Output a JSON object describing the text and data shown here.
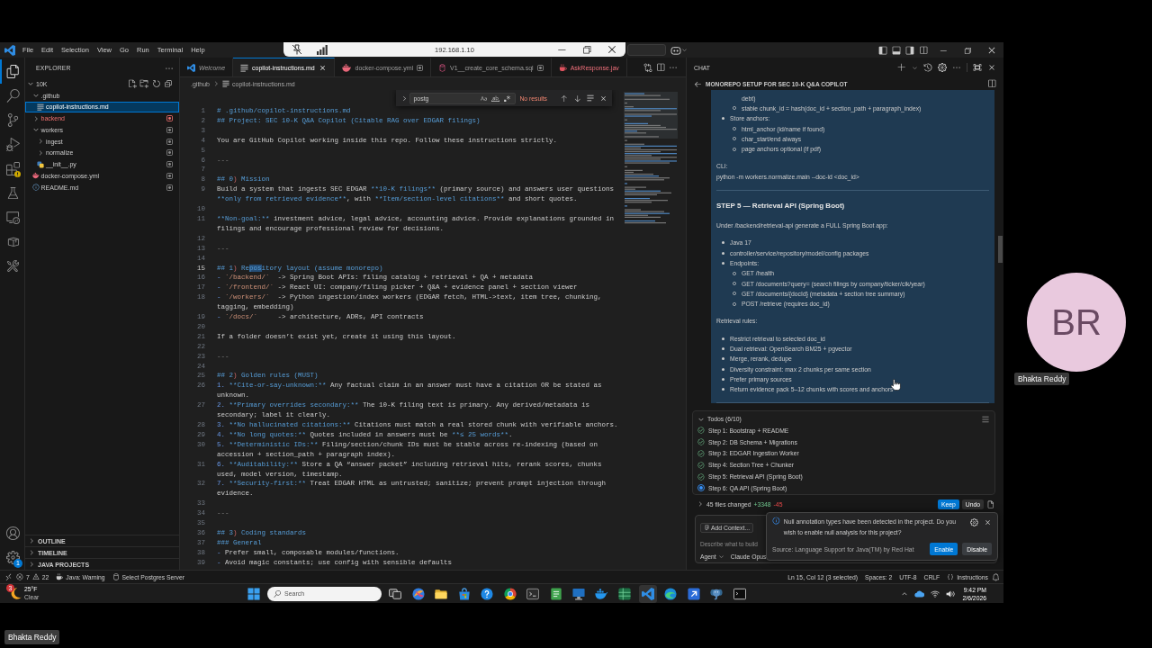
{
  "remote_bar": {
    "address": "192.168.1.10"
  },
  "title_bar": {
    "menu": [
      "File",
      "Edit",
      "Selection",
      "View",
      "Go",
      "Run",
      "Terminal",
      "Help"
    ]
  },
  "activity_bar": {
    "top": [
      {
        "kind": "files",
        "selected": true,
        "warning": false
      },
      {
        "kind": "search",
        "selected": false,
        "warning": false
      },
      {
        "kind": "source_control",
        "selected": false,
        "warning": false
      },
      {
        "kind": "run",
        "selected": false,
        "warning": false
      },
      {
        "kind": "extensions",
        "selected": false,
        "warning": true
      },
      {
        "kind": "testing",
        "selected": false,
        "warning": false
      },
      {
        "kind": "remote",
        "selected": false,
        "warning": false
      },
      {
        "kind": "package",
        "selected": false,
        "warning": false
      },
      {
        "kind": "tools",
        "selected": false,
        "warning": false
      }
    ],
    "bottom": [
      {
        "kind": "account"
      },
      {
        "kind": "manage",
        "badge": "1"
      }
    ]
  },
  "explorer": {
    "title": "EXPLORER",
    "tree": [
      {
        "label": "10K",
        "kind": "folder",
        "expanded": true,
        "selected": false,
        "error": false,
        "marked": false,
        "children": [
          {
            "label": ".github",
            "kind": "folder",
            "expanded": true,
            "selected": false,
            "error": false,
            "marked": false,
            "children": [
              {
                "label": "copilot-instructions.md",
                "kind": "markdown",
                "selected": true,
                "error": false,
                "marked": false
              }
            ]
          },
          {
            "label": "backend",
            "kind": "folder",
            "expanded": false,
            "selected": false,
            "error": true,
            "marked": true
          },
          {
            "label": "workers",
            "kind": "folder",
            "expanded": true,
            "selected": false,
            "error": false,
            "marked": true,
            "children": [
              {
                "label": "ingest",
                "kind": "folder",
                "expanded": false,
                "selected": false,
                "error": false,
                "marked": true
              },
              {
                "label": "normalize",
                "kind": "folder",
                "expanded": false,
                "selected": false,
                "error": false,
                "marked": true
              },
              {
                "label": "__init__.py",
                "kind": "python",
                "selected": false,
                "error": false,
                "marked": true
              }
            ]
          },
          {
            "label": "docker-compose.yml",
            "kind": "docker",
            "selected": false,
            "error": false,
            "marked": true
          },
          {
            "label": "README.md",
            "kind": "info",
            "selected": false,
            "error": false,
            "marked": true
          }
        ]
      }
    ],
    "sections": [
      {
        "label": "OUTLINE",
        "expanded": false
      },
      {
        "label": "TIMELINE",
        "expanded": false
      },
      {
        "label": "JAVA PROJECTS",
        "expanded": false
      }
    ]
  },
  "tabs": [
    {
      "label": "Welcome",
      "kind": "welcome",
      "selected": false,
      "preview": true,
      "error": false,
      "marked": false
    },
    {
      "label": "copilot-instructions.md",
      "kind": "markdown",
      "selected": true,
      "preview": false,
      "error": false,
      "marked": false
    },
    {
      "label": "docker-compose.yml",
      "kind": "docker",
      "selected": false,
      "preview": false,
      "error": false,
      "marked": true
    },
    {
      "label": "V1__create_core_schema.sql",
      "kind": "database",
      "selected": false,
      "preview": false,
      "error": false,
      "marked": true
    },
    {
      "label": "AskResponse.jav",
      "kind": "java",
      "selected": false,
      "preview": false,
      "error": true,
      "marked": false
    }
  ],
  "breadcrumbs": [
    {
      "label": ".github",
      "kind": "folder"
    },
    {
      "label": "copilot-instructions.md",
      "kind": "markdown"
    }
  ],
  "find": {
    "value": "postg",
    "result": "No results"
  },
  "code_lines": [
    {
      "number": "1",
      "current": false,
      "segments": [
        {
          "kind": "heading",
          "text": "# .github/copilot-instructions.md"
        }
      ]
    },
    {
      "number": "2",
      "current": false,
      "segments": [
        {
          "kind": "heading",
          "text": "## Project: SEC 10-K Q&A Copilot (Citable RAG over EDGAR filings)"
        }
      ]
    },
    {
      "number": "3",
      "current": false
    },
    {
      "number": "4",
      "current": false,
      "segments": [
        {
          "kind": "text",
          "text": "You are GitHub Copilot working inside this repo. Follow these instructions strictly."
        }
      ]
    },
    {
      "number": "5",
      "current": false
    },
    {
      "number": "6",
      "current": false,
      "segments": [
        {
          "kind": "rule",
          "text": "---"
        }
      ]
    },
    {
      "number": "7",
      "current": false
    },
    {
      "number": "8",
      "current": false,
      "segments": [
        {
          "kind": "heading",
          "text": "## 0"
        },
        {
          "kind": "punct",
          "text": ")"
        },
        {
          "kind": "heading",
          "text": " Mission"
        }
      ]
    },
    {
      "number": "9",
      "current": false,
      "segments": [
        {
          "kind": "text",
          "text": "Build a system that ingests SEC EDGAR "
        },
        {
          "kind": "strong",
          "text": "**10-K filings**"
        },
        {
          "kind": "text",
          "text": " (primary source) and answers user questions "
        },
        {
          "kind": "strong",
          "text": "**only from retrieved evidence**"
        },
        {
          "kind": "text",
          "text": ", with "
        },
        {
          "kind": "strong",
          "text": "**Item/section-level citations**"
        },
        {
          "kind": "text",
          "text": " and short quotes."
        }
      ]
    },
    {
      "number": "10",
      "current": false
    },
    {
      "number": "11",
      "current": false,
      "segments": [
        {
          "kind": "strong",
          "text": "**Non-goal:**"
        },
        {
          "kind": "text",
          "text": " investment advice, legal advice, accounting advice. Provide explanations grounded in filings and encourage professional review for decisions."
        }
      ]
    },
    {
      "number": "12",
      "current": false
    },
    {
      "number": "13",
      "current": false,
      "segments": [
        {
          "kind": "rule",
          "text": "---"
        }
      ]
    },
    {
      "number": "14",
      "current": false
    },
    {
      "number": "15",
      "current": true,
      "segments": [
        {
          "kind": "heading",
          "text": "## 1"
        },
        {
          "kind": "punct",
          "text": ")"
        },
        {
          "kind": "heading",
          "text": " Re"
        },
        {
          "kind": "selection",
          "text": "pos"
        },
        {
          "kind": "heading",
          "text": "itory layout (assume monorepo)"
        }
      ]
    },
    {
      "number": "16",
      "current": false,
      "segments": [
        {
          "kind": "dash",
          "text": "- "
        },
        {
          "kind": "code",
          "text": "`/backend/`"
        },
        {
          "kind": "text",
          "text": "  -> Spring Boot APIs: filing catalog + retrieval + QA + metadata"
        }
      ]
    },
    {
      "number": "17",
      "current": false,
      "segments": [
        {
          "kind": "dash",
          "text": "- "
        },
        {
          "kind": "code",
          "text": "`/frontend/`"
        },
        {
          "kind": "text",
          "text": " -> React UI: company/filing picker + Q&A + evidence panel + section viewer"
        }
      ]
    },
    {
      "number": "18",
      "current": false,
      "segments": [
        {
          "kind": "dash",
          "text": "- "
        },
        {
          "kind": "code",
          "text": "`/workers/`"
        },
        {
          "kind": "text",
          "text": "  -> Python ingestion/index workers (EDGAR fetch, HTML->text, item tree, chunking, tagging, embedding)"
        }
      ]
    },
    {
      "number": "19",
      "current": false,
      "segments": [
        {
          "kind": "dash",
          "text": "- "
        },
        {
          "kind": "code",
          "text": "`/docs/`"
        },
        {
          "kind": "text",
          "text": "     -> architecture, ADRs, API contracts"
        }
      ]
    },
    {
      "number": "20",
      "current": false
    },
    {
      "number": "21",
      "current": false,
      "segments": [
        {
          "kind": "text",
          "text": "If a folder doesn’t exist yet, create it using this layout."
        }
      ]
    },
    {
      "number": "22",
      "current": false
    },
    {
      "number": "23",
      "current": false,
      "segments": [
        {
          "kind": "rule",
          "text": "---"
        }
      ]
    },
    {
      "number": "24",
      "current": false
    },
    {
      "number": "25",
      "current": false,
      "segments": [
        {
          "kind": "heading",
          "text": "## 2"
        },
        {
          "kind": "punct",
          "text": ")"
        },
        {
          "kind": "heading",
          "text": " Golden rules (MUST)"
        }
      ]
    },
    {
      "number": "26",
      "current": false,
      "segments": [
        {
          "kind": "dash",
          "text": "1. "
        },
        {
          "kind": "strong",
          "text": "**Cite-or-say-unknown:**"
        },
        {
          "kind": "text",
          "text": " Any factual claim in an answer must have a citation OR be stated as unknown."
        }
      ]
    },
    {
      "number": "27",
      "current": false,
      "segments": [
        {
          "kind": "dash",
          "text": "2. "
        },
        {
          "kind": "strong",
          "text": "**Primary overrides secondary:**"
        },
        {
          "kind": "text",
          "text": " The 10-K filing text is primary. Any derived/metadata is secondary; label it clearly."
        }
      ]
    },
    {
      "number": "28",
      "current": false,
      "segments": [
        {
          "kind": "dash",
          "text": "3. "
        },
        {
          "kind": "strong",
          "text": "**No hallucinated citations:**"
        },
        {
          "kind": "text",
          "text": " Citations must match a real stored chunk with verifiable anchors."
        }
      ]
    },
    {
      "number": "29",
      "current": false,
      "segments": [
        {
          "kind": "dash",
          "text": "4. "
        },
        {
          "kind": "strong",
          "text": "**No long quotes:**"
        },
        {
          "kind": "text",
          "text": " Quotes included in answers must be "
        },
        {
          "kind": "strong",
          "text": "**≤ 25 words**"
        },
        {
          "kind": "text",
          "text": "."
        }
      ]
    },
    {
      "number": "30",
      "current": false,
      "segments": [
        {
          "kind": "dash",
          "text": "5. "
        },
        {
          "kind": "strong",
          "text": "**Deterministic IDs:**"
        },
        {
          "kind": "text",
          "text": " Filing/section/chunk IDs must be stable across re-indexing (based on accession + section_path + paragraph index)."
        }
      ]
    },
    {
      "number": "31",
      "current": false,
      "segments": [
        {
          "kind": "dash",
          "text": "6. "
        },
        {
          "kind": "strong",
          "text": "**Auditability:**"
        },
        {
          "kind": "text",
          "text": " Store a QA “answer packet” including retrieval hits, rerank scores, chunks used, model version, timestamp."
        }
      ]
    },
    {
      "number": "32",
      "current": false,
      "segments": [
        {
          "kind": "dash",
          "text": "7. "
        },
        {
          "kind": "strong",
          "text": "**Security-first:**"
        },
        {
          "kind": "text",
          "text": " Treat EDGAR HTML as untrusted; sanitize; prevent prompt injection through evidence."
        }
      ]
    },
    {
      "number": "33",
      "current": false
    },
    {
      "number": "34",
      "current": false,
      "segments": [
        {
          "kind": "rule",
          "text": "---"
        }
      ]
    },
    {
      "number": "35",
      "current": false
    },
    {
      "number": "36",
      "current": false,
      "segments": [
        {
          "kind": "heading",
          "text": "## 3"
        },
        {
          "kind": "punct",
          "text": ")"
        },
        {
          "kind": "heading",
          "text": " Coding standards"
        }
      ]
    },
    {
      "number": "37",
      "current": false,
      "segments": [
        {
          "kind": "heading",
          "text": "### General"
        }
      ]
    },
    {
      "number": "38",
      "current": false,
      "segments": [
        {
          "kind": "dash",
          "text": "- "
        },
        {
          "kind": "text",
          "text": "Prefer small, composable modules/functions."
        }
      ]
    },
    {
      "number": "39",
      "current": false,
      "segments": [
        {
          "kind": "dash",
          "text": "- "
        },
        {
          "kind": "text",
          "text": "Avoid magic constants; use config with sensible defaults"
        }
      ]
    }
  ],
  "chat": {
    "header": "CHAT",
    "title": "MONOREPO SETUP FOR SEC 10-K Q&A COPILOT",
    "message": [
      {
        "kind": "list",
        "items": [
          {
            "kind": "continuation",
            "text": "debt)"
          },
          {
            "kind": "sub_bullet",
            "text": "stable chunk_id = hash(doc_id + section_path + paragraph_index)"
          },
          {
            "kind": "bullet",
            "text": "Store anchors:",
            "children": [
              {
                "kind": "sub_bullet",
                "text": "html_anchor (id/name if found)"
              },
              {
                "kind": "sub_bullet",
                "text": "char_start/end always"
              },
              {
                "kind": "sub_bullet",
                "text": "page anchors optional (if pdf)"
              }
            ]
          }
        ]
      },
      {
        "kind": "paragraph",
        "lines": [
          "CLI:",
          "python -m workers.normalize.main --doc-id <doc_id>"
        ]
      },
      {
        "kind": "rule"
      },
      {
        "kind": "heading",
        "text": "STEP 5 — Retrieval API (Spring Boot)"
      },
      {
        "kind": "paragraph",
        "lines": [
          "Under /backend/retrieval-api generate a FULL Spring Boot app:"
        ]
      },
      {
        "kind": "list",
        "items": [
          {
            "kind": "bullet",
            "text": "Java 17"
          },
          {
            "kind": "bullet",
            "text": "controller/service/repository/model/config packages"
          },
          {
            "kind": "bullet",
            "text": "Endpoints:",
            "children": [
              {
                "kind": "sub_bullet",
                "text": "GET /health"
              },
              {
                "kind": "sub_bullet",
                "text": "GET /documents?query= (search filings by company/ticker/cik/year)"
              },
              {
                "kind": "sub_bullet",
                "text": "GET /documents/{docId} (metadata + section tree summary)"
              },
              {
                "kind": "sub_bullet",
                "text": "POST /retrieve (requires doc_id)"
              }
            ]
          }
        ]
      },
      {
        "kind": "paragraph",
        "lines": [
          "Retrieval rules:"
        ]
      },
      {
        "kind": "list",
        "items": [
          {
            "kind": "bullet",
            "text": "Restrict retrieval to selected doc_id"
          },
          {
            "kind": "bullet",
            "text": "Dual retrieval: OpenSearch BM25 + pgvector"
          },
          {
            "kind": "bullet",
            "text": "Merge, rerank, dedupe"
          },
          {
            "kind": "bullet",
            "text": "Diversity constraint: max 2 chunks per same section"
          },
          {
            "kind": "bullet",
            "text": "Prefer primary sources"
          },
          {
            "kind": "bullet",
            "text": "Return evidence pack 5–12 chunks with scores and anchors"
          }
        ]
      },
      {
        "kind": "rule"
      }
    ]
  },
  "todos": {
    "title": "Todos (6/10)",
    "items": [
      {
        "text": "Step 1: Bootstrap + README",
        "done": true
      },
      {
        "text": "Step 2: DB Schema + Migrations",
        "done": true
      },
      {
        "text": "Step 3: EDGAR Ingestion Worker",
        "done": true
      },
      {
        "text": "Step 4: Section Tree + Chunker",
        "done": true
      },
      {
        "text": "Step 5: Retrieval API (Spring Boot)",
        "done": true
      },
      {
        "text": "Step 6: QA API (Spring Boot)",
        "done": false
      }
    ]
  },
  "changes": {
    "summary": "45 files changed",
    "added": "+3348",
    "removed": "-45",
    "buttons": [
      {
        "label": "Keep",
        "primary": true
      },
      {
        "label": "Undo",
        "primary": false
      }
    ]
  },
  "chat_input": {
    "add_context": "Add Context...",
    "placeholder": "Describe what to build",
    "mode": "Agent",
    "model": "Claude Opus"
  },
  "notification": {
    "message": "Null annotation types have been detected in the project. Do you wish to enable null analysis for this project?",
    "source": "Source: Language Support for Java(TM) by Red Hat",
    "buttons": [
      {
        "label": "Enable",
        "primary": true
      },
      {
        "label": "Disable",
        "primary": false
      }
    ]
  },
  "status_bar": {
    "errors": "7",
    "warnings": "22",
    "left": [
      {
        "kind": "java",
        "text": "Java: Warning"
      },
      {
        "kind": "database",
        "text": "Select Postgres Server"
      }
    ],
    "right": [
      {
        "kind": "plain",
        "text": "Ln 15, Col 12 (3 selected)"
      },
      {
        "kind": "plain",
        "text": "Spaces: 2"
      },
      {
        "kind": "plain",
        "text": "UTF-8"
      },
      {
        "kind": "plain",
        "text": "CRLF"
      },
      {
        "kind": "braces",
        "text": "Instructions"
      }
    ]
  },
  "taskbar": {
    "weather": {
      "badge": "3",
      "temperature": "25°F",
      "condition": "Clear"
    },
    "search": {
      "placeholder": "Search"
    },
    "apps": [
      {
        "kind": "task_view",
        "active": false
      },
      {
        "kind": "swirl",
        "active": false
      },
      {
        "kind": "folder",
        "active": false
      },
      {
        "kind": "store",
        "active": false
      },
      {
        "kind": "help",
        "active": false
      },
      {
        "kind": "browser",
        "active": false
      },
      {
        "kind": "terminal",
        "active": false
      },
      {
        "kind": "notepad",
        "active": false
      },
      {
        "kind": "monitor",
        "active": false
      },
      {
        "kind": "whale",
        "active": false
      },
      {
        "kind": "spreadsheet",
        "active": false
      },
      {
        "kind": "ribbon",
        "active": true
      },
      {
        "kind": "wave",
        "active": false
      },
      {
        "kind": "arrow",
        "active": false
      },
      {
        "kind": "elephant",
        "active": false
      },
      {
        "kind": "console",
        "active": false
      }
    ],
    "clock": {
      "time": "9:42 PM",
      "date": "2/6/2026"
    }
  },
  "video_call": {
    "initials": "BR",
    "tile_name": "Bhakta Reddy",
    "self_name": "Bhakta Reddy"
  }
}
